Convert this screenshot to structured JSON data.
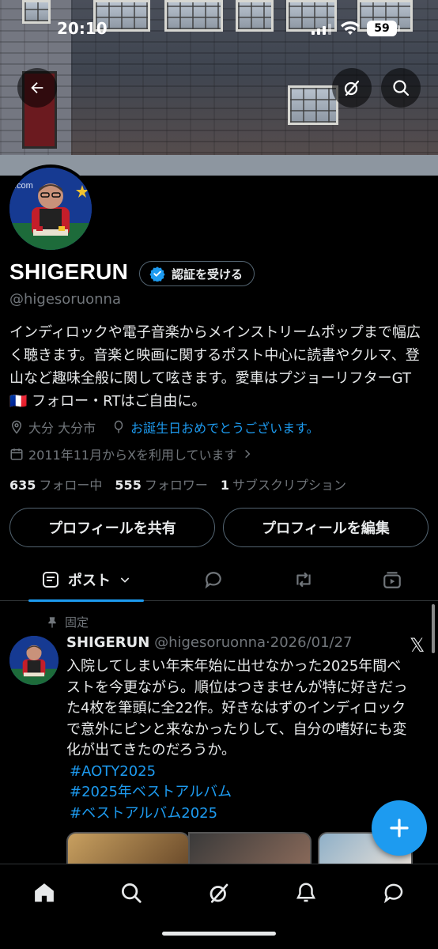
{
  "status_bar": {
    "time": "20:10",
    "battery": "59"
  },
  "profile": {
    "name": "SHIGERUN",
    "verify_label": "認証を受ける",
    "handle": "@higesoruonna",
    "bio": "インディロックや電子音楽からメインストリームポップまで幅広く聴きます。音楽と映画に関するポスト中心に読書やクルマ、登山など趣味全般に関して呟きます。愛車はプジョーリフターGT🇫🇷 フォロー・RTはご自由に。",
    "location": "大分 大分市",
    "birthday": "お誕生日おめでとうございます。",
    "joined": "2011年11月からXを利用しています",
    "following_count": "635",
    "following_label": "フォロー中",
    "followers_count": "555",
    "followers_label": "フォロワー",
    "subs_count": "1",
    "subs_label": "サブスクリプション",
    "share_button": "プロフィールを共有",
    "edit_button": "プロフィールを編集"
  },
  "tabs": {
    "posts_label": "ポスト"
  },
  "post": {
    "pinned_label": "固定",
    "author_name": "SHIGERUN",
    "author_handle": "@higesoruonna",
    "date": "·2026/01/27",
    "text": "入院してしまい年末年始に出せなかった2025年間ベストを今更ながら。順位はつきませんが特に好きだった4枚を筆頭に全22作。好きなはずのインディロックで意外にピンと来なかったりして、自分の嗜好にも変化が出てきたのだろうか。",
    "hashtags": [
      "#AOTY2025",
      "#2025年ベストアルバム",
      "#ベストアルバム2025"
    ]
  },
  "colors": {
    "accent": "#1d9bf0",
    "muted": "#71767b",
    "border": "#2f3336"
  }
}
